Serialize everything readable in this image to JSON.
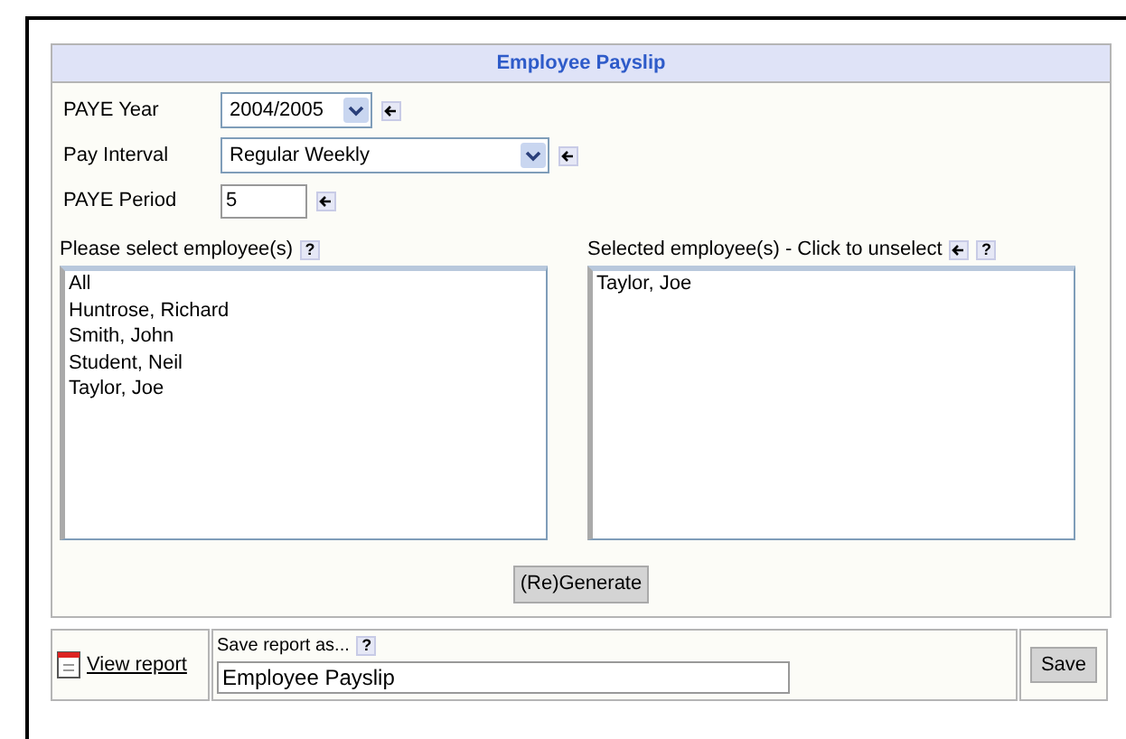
{
  "panel": {
    "title": "Employee Payslip"
  },
  "fields": [
    {
      "label": "PAYE Year",
      "value": "2004/2005",
      "kind": "short_select"
    },
    {
      "label": "Pay Interval",
      "value": "Regular Weekly",
      "kind": "long_select"
    },
    {
      "label": "PAYE Period",
      "value": "5",
      "kind": "text"
    }
  ],
  "available": {
    "label": "Please select employee(s)",
    "help": "?",
    "items": [
      "All",
      "Huntrose, Richard",
      "Smith, John",
      "Student, Neil",
      "Taylor, Joe"
    ]
  },
  "selected": {
    "label": "Selected employee(s) - Click to unselect",
    "help": "?",
    "items": [
      "Taylor, Joe"
    ]
  },
  "generate_button": "(Re)Generate",
  "footer": {
    "view_report": "View report",
    "save_label": "Save report as...",
    "save_help": "?",
    "save_value": "Employee Payslip",
    "save_button": "Save"
  }
}
